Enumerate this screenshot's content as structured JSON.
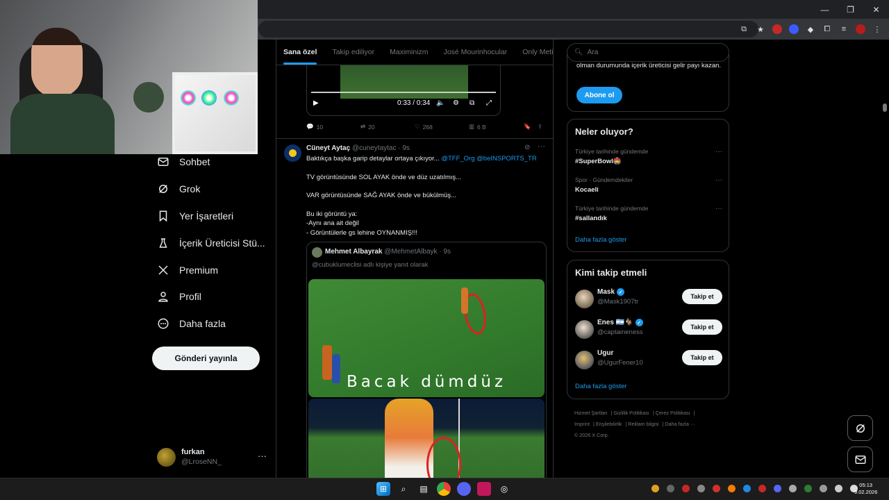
{
  "taskbar": {
    "time": "05:13",
    "date": "9.02.2026"
  },
  "nav": {
    "items": [
      {
        "label": "Sohbet"
      },
      {
        "label": "Grok"
      },
      {
        "label": "Yer İşaretleri"
      },
      {
        "label": "İçerik Üreticisi Stü..."
      },
      {
        "label": "Premium"
      },
      {
        "label": "Profil"
      },
      {
        "label": "Daha fazla"
      }
    ],
    "post_button": "Gönderi yayınla",
    "account": {
      "name": "furkan",
      "handle": "@LroseNN_",
      "more": "···"
    }
  },
  "feed": {
    "tabs": [
      "Sana özel",
      "Takip ediliyor",
      "Maximinizm",
      "José Mourinhocular",
      "Only Metin2"
    ],
    "video": {
      "time": "0:33 / 0:34"
    },
    "post1_actions": {
      "replies": "10",
      "reposts": "20",
      "likes": "268",
      "views": "6 B"
    },
    "post2": {
      "name": "Cüneyt Aytaç",
      "handle": "@cuneytaytac",
      "time": "· 9s",
      "line1": "Baktıkça başka garip detaylar ortaya çıkıyor...",
      "mention1": "@TFF_Org",
      "mention2": "@beINSPORTS_TR",
      "line2": "TV görüntüsünde SOL AYAK önde ve düz uzatılmış...",
      "line3": "VAR görüntüsünde SAĞ AYAK önde ve bükülmüş...",
      "line4": "Bu iki görüntü ya:",
      "line5": "-Aynı ana ait değil",
      "line6": "- Görüntülerle gs lehine OYNANMIŞ!!!"
    },
    "quote": {
      "name": "Mehmet Albayrak",
      "handle": "@MehmetAlbayk",
      "time": "· 9s",
      "reply": "@cubuklumeclisi adlı kişiye yanıt olarak",
      "caption": "Bacak dümdüz"
    }
  },
  "right": {
    "search_placeholder": "Ara",
    "subscribe_text": "olman durumunda içerik üreticisi gelir payı kazan.",
    "subscribe_button": "Abone ol",
    "trends_title": "Neler oluyor?",
    "trends": [
      {
        "context": "Türkiye tarihinde gündemde",
        "name": "#SuperBowl🏟️"
      },
      {
        "context": "Spor · Gündemdekiler",
        "name": "Kocaeli"
      },
      {
        "context": "Türkiye tarihinde gündemde",
        "name": "#sallandık"
      }
    ],
    "show_more": "Daha fazla göster",
    "follow_title": "Kimi takip etmeli",
    "follow": [
      {
        "name": "Mask",
        "handle": "@Mask1907tr",
        "button": "Takip et"
      },
      {
        "name": "Enes 🇦🇷🐐",
        "handle": "@captaineness",
        "button": "Takip et"
      },
      {
        "name": "Ugur",
        "handle": "@UgurFener10",
        "button": "Takip et"
      }
    ],
    "footer": [
      "Hizmet Şartları",
      "Gizlilik Politikası",
      "Çerez Politikası",
      "Imprint",
      "Erişilebilirlik",
      "Reklam bilgisi",
      "Daha fazla ···",
      "© 2026 X Corp."
    ]
  }
}
